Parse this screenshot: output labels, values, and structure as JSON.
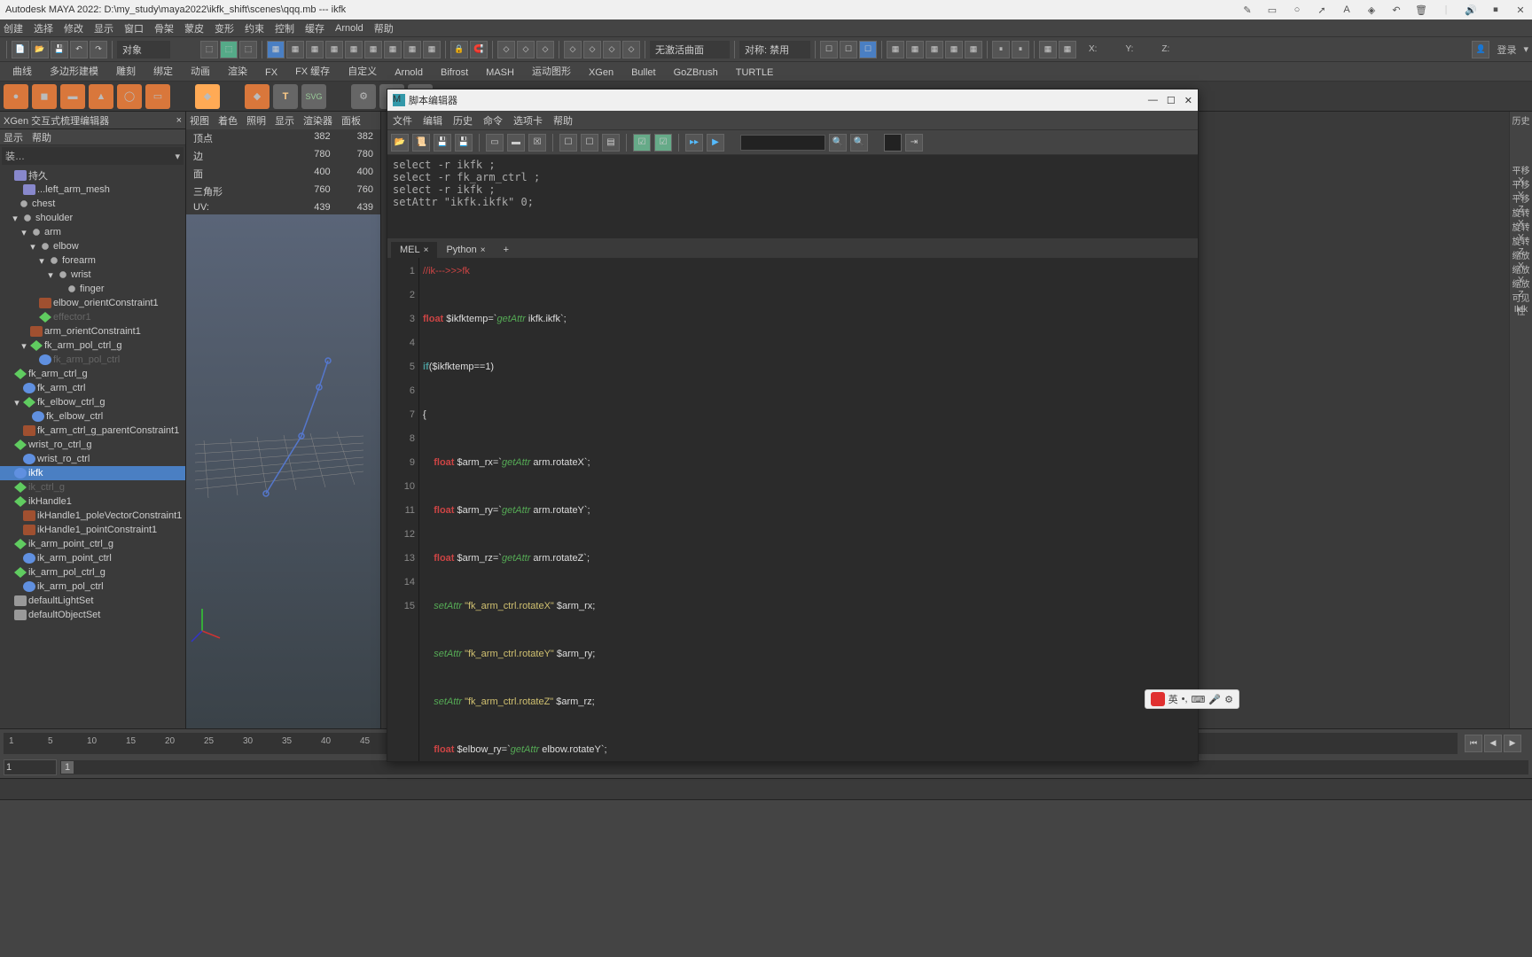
{
  "title": "Autodesk MAYA 2022: D:\\my_study\\maya2022\\ikfk_shift\\scenes\\qqq.mb  ---  ikfk",
  "mainMenu": [
    "创建",
    "选择",
    "修改",
    "显示",
    "窗口",
    "骨架",
    "蒙皮",
    "变形",
    "约束",
    "控制",
    "缓存",
    "Arnold",
    "帮助"
  ],
  "toolbar1": {
    "modeDropdown": "对象",
    "curveDropdown": "无激活曲面",
    "symDropdown": "对称: 禁用",
    "login": "登录"
  },
  "tabsRow": [
    "曲线",
    "多边形建模",
    "雕刻",
    "绑定",
    "动画",
    "渲染",
    "FX",
    "FX 缓存",
    "自定义",
    "Arnold",
    "Bifrost",
    "MASH",
    "运动图形",
    "XGen",
    "Bullet",
    "GoZBrush",
    "TURTLE"
  ],
  "leftPanel": {
    "header1": "XGen 交互式梳理编辑器",
    "row2": [
      "显示",
      "帮助"
    ],
    "dropdown": "装…",
    "outliner": [
      {
        "exp": "",
        "icon": "mesh",
        "label": "持久",
        "pad": 0,
        "gray": false,
        "sel": false
      },
      {
        "exp": "",
        "icon": "mesh",
        "label": "...left_arm_mesh",
        "pad": 10,
        "gray": false,
        "sel": false
      },
      {
        "exp": "",
        "icon": "joint",
        "label": "chest",
        "pad": 4,
        "gray": false,
        "sel": false
      },
      {
        "exp": "▾",
        "icon": "joint",
        "label": "shoulder",
        "pad": 8,
        "gray": false,
        "sel": false
      },
      {
        "exp": "▾",
        "icon": "joint",
        "label": "arm",
        "pad": 18,
        "gray": false,
        "sel": false
      },
      {
        "exp": "▾",
        "icon": "joint",
        "label": "elbow",
        "pad": 28,
        "gray": false,
        "sel": false
      },
      {
        "exp": "▾",
        "icon": "joint",
        "label": "forearm",
        "pad": 38,
        "gray": false,
        "sel": false
      },
      {
        "exp": "▾",
        "icon": "joint",
        "label": "wrist",
        "pad": 48,
        "gray": false,
        "sel": false
      },
      {
        "exp": "",
        "icon": "joint",
        "label": "finger",
        "pad": 58,
        "gray": false,
        "sel": false
      },
      {
        "exp": "",
        "icon": "constraint",
        "label": "elbow_orientConstraint1",
        "pad": 28,
        "gray": false,
        "sel": false
      },
      {
        "exp": "",
        "icon": "loc",
        "label": "effector1",
        "pad": 28,
        "gray": true,
        "sel": false
      },
      {
        "exp": "",
        "icon": "constraint",
        "label": "arm_orientConstraint1",
        "pad": 18,
        "gray": false,
        "sel": false
      },
      {
        "exp": "▾",
        "icon": "loc",
        "label": "fk_arm_pol_ctrl_g",
        "pad": 18,
        "gray": false,
        "sel": false
      },
      {
        "exp": "",
        "icon": "curve",
        "label": "fk_arm_pol_ctrl",
        "pad": 28,
        "gray": true,
        "sel": false
      },
      {
        "exp": "",
        "icon": "loc",
        "label": "fk_arm_ctrl_g",
        "pad": 0,
        "gray": false,
        "sel": false
      },
      {
        "exp": "",
        "icon": "curve",
        "label": "fk_arm_ctrl",
        "pad": 10,
        "gray": false,
        "sel": false
      },
      {
        "exp": "▾",
        "icon": "loc",
        "label": "fk_elbow_ctrl_g",
        "pad": 10,
        "gray": false,
        "sel": false
      },
      {
        "exp": "",
        "icon": "curve",
        "label": "fk_elbow_ctrl",
        "pad": 20,
        "gray": false,
        "sel": false
      },
      {
        "exp": "",
        "icon": "constraint",
        "label": "fk_arm_ctrl_g_parentConstraint1",
        "pad": 10,
        "gray": false,
        "sel": false
      },
      {
        "exp": "",
        "icon": "loc",
        "label": "wrist_ro_ctrl_g",
        "pad": 0,
        "gray": false,
        "sel": false
      },
      {
        "exp": "",
        "icon": "curve",
        "label": "wrist_ro_ctrl",
        "pad": 10,
        "gray": false,
        "sel": false
      },
      {
        "exp": "",
        "icon": "curve",
        "label": "ikfk",
        "pad": 0,
        "gray": false,
        "sel": true
      },
      {
        "exp": "",
        "icon": "loc",
        "label": "ik_ctrl_g",
        "pad": 0,
        "gray": true,
        "sel": false
      },
      {
        "exp": "",
        "icon": "loc",
        "label": "ikHandle1",
        "pad": 0,
        "gray": false,
        "sel": false
      },
      {
        "exp": "",
        "icon": "constraint",
        "label": "ikHandle1_poleVectorConstraint1",
        "pad": 10,
        "gray": false,
        "sel": false
      },
      {
        "exp": "",
        "icon": "constraint",
        "label": "ikHandle1_pointConstraint1",
        "pad": 10,
        "gray": false,
        "sel": false
      },
      {
        "exp": "",
        "icon": "loc",
        "label": "ik_arm_point_ctrl_g",
        "pad": 0,
        "gray": false,
        "sel": false
      },
      {
        "exp": "",
        "icon": "curve",
        "label": "ik_arm_point_ctrl",
        "pad": 10,
        "gray": false,
        "sel": false
      },
      {
        "exp": "",
        "icon": "loc",
        "label": "ik_arm_pol_ctrl_g",
        "pad": 0,
        "gray": false,
        "sel": false
      },
      {
        "exp": "",
        "icon": "curve",
        "label": "ik_arm_pol_ctrl",
        "pad": 10,
        "gray": false,
        "sel": false
      },
      {
        "exp": "",
        "icon": "set",
        "label": "defaultLightSet",
        "pad": 0,
        "gray": false,
        "sel": false
      },
      {
        "exp": "",
        "icon": "set",
        "label": "defaultObjectSet",
        "pad": 0,
        "gray": false,
        "sel": false
      }
    ]
  },
  "viewport": {
    "menu": [
      "视图",
      "着色",
      "照明",
      "显示",
      "渲染器",
      "面板"
    ],
    "stats": [
      {
        "label": "顶点",
        "v1": "382",
        "v2": "382"
      },
      {
        "label": "边",
        "v1": "780",
        "v2": "780"
      },
      {
        "label": "面",
        "v1": "400",
        "v2": "400"
      },
      {
        "label": "三角形",
        "v1": "760",
        "v2": "760"
      },
      {
        "label": "UV:",
        "v1": "439",
        "v2": "439"
      }
    ]
  },
  "rightStrip": [
    "历史",
    "平移 X",
    "平移 Y",
    "平移 Z",
    "旋转 X",
    "旋转 Y",
    "旋转 Z",
    "缩放 X",
    "缩放 Y",
    "缩放 Z",
    "可见性",
    "Ikfk"
  ],
  "timeline": {
    "ticks": [
      "1",
      "5",
      "10",
      "15",
      "20",
      "25",
      "30",
      "35",
      "40",
      "45"
    ],
    "start": "1",
    "start2": "1"
  },
  "scriptEditor": {
    "title": "脚本编辑器",
    "menu": [
      "文件",
      "编辑",
      "历史",
      "命令",
      "选项卡",
      "帮助"
    ],
    "history": "select -r ikfk ;\nselect -r fk_arm_ctrl ;\nselect -r ikfk ;\nsetAttr \"ikfk.ikfk\" 0;",
    "tabs": [
      {
        "label": "MEL",
        "active": true
      },
      {
        "label": "Python",
        "active": false
      }
    ],
    "code": {
      "lineNums": [
        "1",
        "2",
        "3",
        "4",
        "5",
        "6",
        "7",
        "8",
        "9",
        "10",
        "11",
        "12",
        "13",
        "14",
        "15"
      ]
    }
  },
  "ime": {
    "lang": "英"
  },
  "axisLabels": {
    "x": "X:",
    "y": "Y:",
    "z": "Z:"
  }
}
